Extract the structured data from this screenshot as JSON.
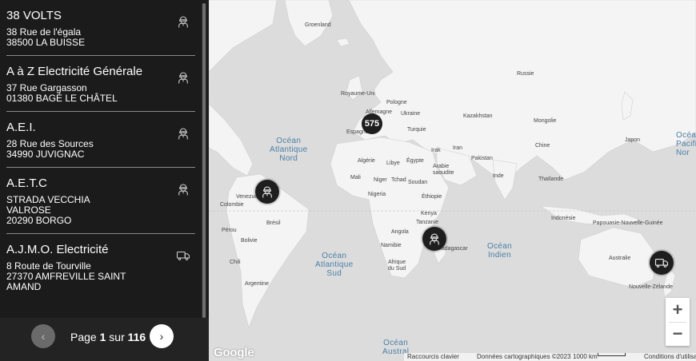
{
  "results": [
    {
      "name": "38 VOLTS",
      "address": [
        "38 Rue de l'égala",
        "38500 LA BUISSE"
      ],
      "icon": "electrician-icon"
    },
    {
      "name": "A à Z Electricité Générale",
      "address": [
        "37 Rue Gargasson",
        "01380 BAGÉ LE CHÂTEL"
      ],
      "icon": "electrician-icon"
    },
    {
      "name": "A.E.I.",
      "address": [
        "28 Rue des Sources",
        "34990 JUVIGNAC"
      ],
      "icon": "electrician-icon"
    },
    {
      "name": "A.E.T.C",
      "address": [
        "STRADA VECCHIA",
        "VALROSE",
        "20290 BORGO"
      ],
      "icon": "electrician-icon"
    },
    {
      "name": "A.J.M.O. Electricité",
      "address": [
        "8 Route de Tourville",
        "27370 AMFREVILLE SAINT",
        "AMAND"
      ],
      "icon": "truck-icon"
    }
  ],
  "pagination": {
    "prev_glyph": "‹",
    "next_glyph": "›",
    "page_word": "Page",
    "current": "1",
    "of_word": "sur",
    "total": "116"
  },
  "map": {
    "cluster_count": "575",
    "oceans": {
      "north_atlantic": [
        "Océan",
        "Atlantique",
        "Nord"
      ],
      "south_atlantic": [
        "Océan",
        "Atlantique",
        "Sud"
      ],
      "indian": [
        "Océan",
        "Indien"
      ],
      "pacific_partial": [
        "Océa",
        "Pacifi",
        "Nor"
      ],
      "austral": [
        "Océan",
        "Austral"
      ]
    },
    "labels": {
      "groenland": "Groenland",
      "russie": "Russie",
      "royaume_uni": "Royaume-Uni",
      "pologne": "Pologne",
      "allemagne": "Allemagne",
      "ukraine": "Ukraine",
      "espagne": "Espagne",
      "turquie": "Turquie",
      "kazakhstan": "Kazakhstan",
      "mongolie": "Mongolie",
      "chine": "Chine",
      "japon": "Japon",
      "irak": "Irak",
      "iran": "Iran",
      "algerie": "Algérie",
      "libye": "Libye",
      "egypte": "Égypte",
      "arabie": [
        "Arabie",
        "saoudite"
      ],
      "pakistan": "Pakistan",
      "inde": "Inde",
      "thailande": "Thaïlande",
      "mali": "Mali",
      "niger": "Niger",
      "tchad": "Tchad",
      "soudan": "Soudan",
      "nigeria": "Nigeria",
      "ethiopie": "Éthiopie",
      "kenya": "Kenya",
      "tanzanie": "Tanzanie",
      "angola": "Angola",
      "namibie": "Namibie",
      "madagascar": "Madagascar",
      "afrique_du_sud": [
        "Afrique",
        "du Sud"
      ],
      "venezuela": "Venezuela",
      "colombie": "Colombie",
      "perou": "Pérou",
      "bresil": "Brésil",
      "bolivie": "Bolivie",
      "chili": "Chili",
      "argentine": "Argentine",
      "indonesie": "Indonésie",
      "png": "Papouasie-Nouvelle-Guinée",
      "australie": "Australie",
      "nz": "Nouvelle-Zélande"
    },
    "zoom_in": "+",
    "zoom_out": "−",
    "google_logo": "Google",
    "attribution": {
      "shortcuts": "Raccourcis clavier",
      "map_data": "Données cartographiques ©2023",
      "scale": "1000 km",
      "terms": "Conditions d'utilisation"
    }
  }
}
